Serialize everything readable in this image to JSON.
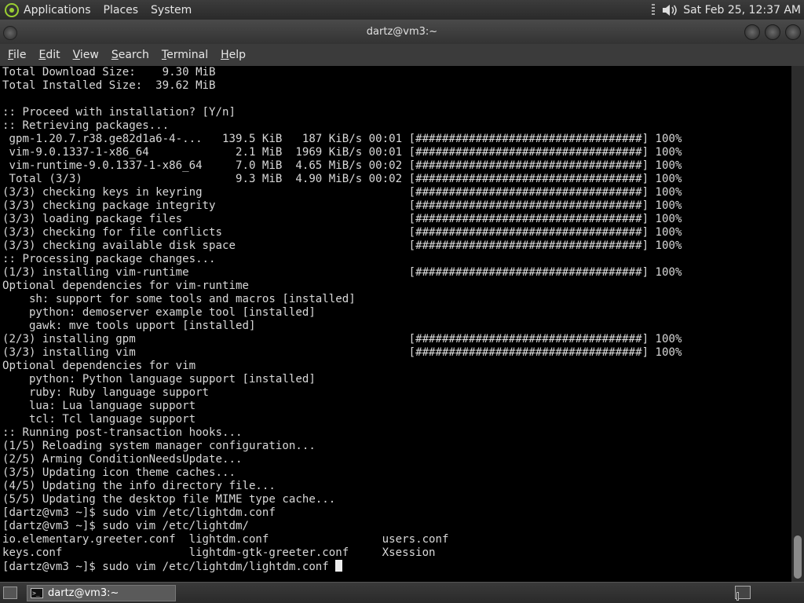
{
  "top_panel": {
    "menus": [
      "Applications",
      "Places",
      "System"
    ],
    "clock": "Sat Feb 25, 12:37 AM"
  },
  "window": {
    "title": "dartz@vm3:~"
  },
  "menubar": {
    "items": [
      {
        "accel": "F",
        "rest": "ile"
      },
      {
        "accel": "E",
        "rest": "dit"
      },
      {
        "accel": "V",
        "rest": "iew"
      },
      {
        "accel": "S",
        "rest": "earch"
      },
      {
        "accel": "T",
        "rest": "erminal"
      },
      {
        "accel": "H",
        "rest": "elp"
      }
    ]
  },
  "terminal": {
    "lines": [
      "Total Download Size:    9.30 MiB",
      "Total Installed Size:  39.62 MiB",
      "",
      ":: Proceed with installation? [Y/n]",
      ":: Retrieving packages...",
      " gpm-1.20.7.r38.ge82d1a6-4-...   139.5 KiB   187 KiB/s 00:01 [##################################] 100%",
      " vim-9.0.1337-1-x86_64             2.1 MiB  1969 KiB/s 00:01 [##################################] 100%",
      " vim-runtime-9.0.1337-1-x86_64     7.0 MiB  4.65 MiB/s 00:02 [##################################] 100%",
      " Total (3/3)                       9.3 MiB  4.90 MiB/s 00:02 [##################################] 100%",
      "(3/3) checking keys in keyring                               [##################################] 100%",
      "(3/3) checking package integrity                             [##################################] 100%",
      "(3/3) loading package files                                  [##################################] 100%",
      "(3/3) checking for file conflicts                            [##################################] 100%",
      "(3/3) checking available disk space                          [##################################] 100%",
      ":: Processing package changes...",
      "(1/3) installing vim-runtime                                 [##################################] 100%",
      "Optional dependencies for vim-runtime",
      "    sh: support for some tools and macros [installed]",
      "    python: demoserver example tool [installed]",
      "    gawk: mve tools upport [installed]",
      "(2/3) installing gpm                                         [##################################] 100%",
      "(3/3) installing vim                                         [##################################] 100%",
      "Optional dependencies for vim",
      "    python: Python language support [installed]",
      "    ruby: Ruby language support",
      "    lua: Lua language support",
      "    tcl: Tcl language support",
      ":: Running post-transaction hooks...",
      "(1/5) Reloading system manager configuration...",
      "(2/5) Arming ConditionNeedsUpdate...",
      "(3/5) Updating icon theme caches...",
      "(4/5) Updating the info directory file...",
      "(5/5) Updating the desktop file MIME type cache...",
      "[dartz@vm3 ~]$ sudo vim /etc/lightdm.conf",
      "[dartz@vm3 ~]$ sudo vim /etc/lightdm/",
      "io.elementary.greeter.conf  lightdm.conf                 users.conf",
      "keys.conf                   lightdm-gtk-greeter.conf     Xsession"
    ],
    "prompt_line": "[dartz@vm3 ~]$ sudo vim /etc/lightdm/lightdm.conf "
  },
  "taskbar": {
    "task_label": "dartz@vm3:~"
  },
  "icons": {
    "menu_logo": "gnome-foot-icon",
    "volume": "speaker-icon",
    "terminal": "terminal-icon"
  }
}
